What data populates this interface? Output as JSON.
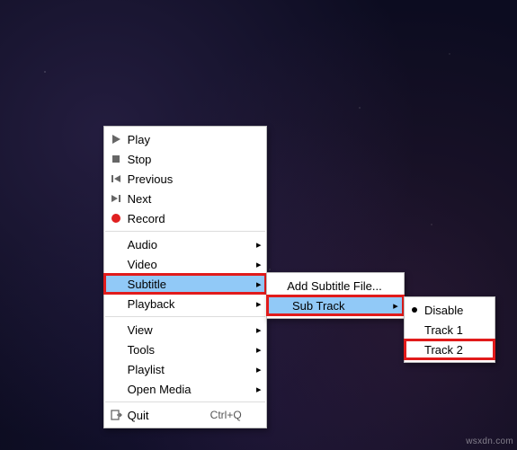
{
  "main_menu": {
    "play": {
      "label": "Play"
    },
    "stop": {
      "label": "Stop"
    },
    "previous": {
      "label": "Previous"
    },
    "next": {
      "label": "Next"
    },
    "record": {
      "label": "Record"
    },
    "audio": {
      "label": "Audio"
    },
    "video": {
      "label": "Video"
    },
    "subtitle": {
      "label": "Subtitle"
    },
    "playback": {
      "label": "Playback"
    },
    "view": {
      "label": "View"
    },
    "tools": {
      "label": "Tools"
    },
    "playlist": {
      "label": "Playlist"
    },
    "open_media": {
      "label": "Open Media"
    },
    "quit": {
      "label": "Quit",
      "shortcut": "Ctrl+Q"
    }
  },
  "subtitle_menu": {
    "add_file": {
      "label": "Add Subtitle File..."
    },
    "sub_track": {
      "label": "Sub Track"
    }
  },
  "subtrack_menu": {
    "disable": {
      "label": "Disable",
      "selected": true
    },
    "track1": {
      "label": "Track 1"
    },
    "track2": {
      "label": "Track 2"
    }
  },
  "submenu_arrow": "▸",
  "watermark": "wsxdn.com",
  "chart_data": null
}
